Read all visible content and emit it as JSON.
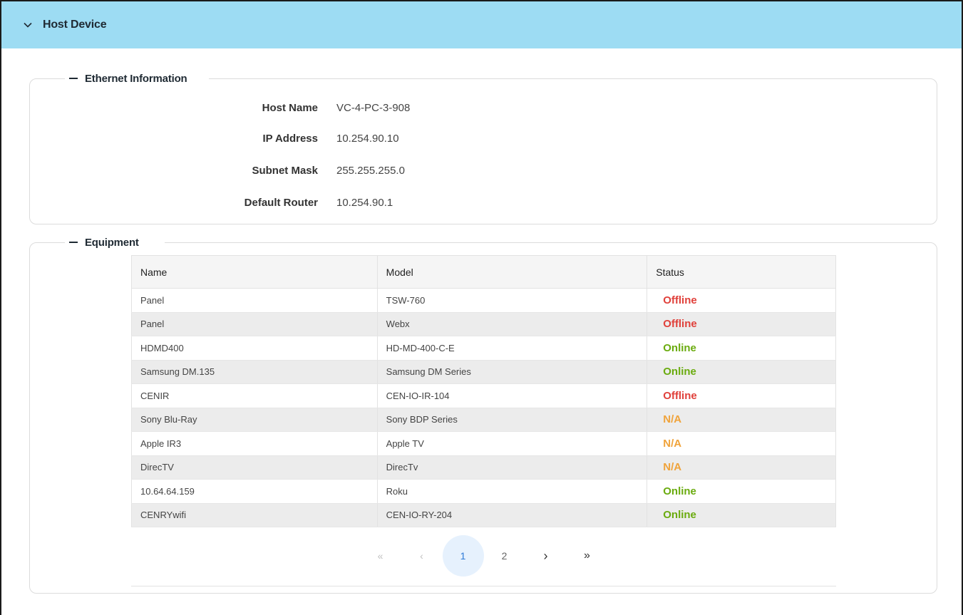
{
  "header": {
    "title": "Host Device",
    "icon": "chevron-down-icon"
  },
  "ethernet": {
    "legend": "Ethernet Information",
    "rows": [
      {
        "label": "Host Name",
        "value": "VC-4-PC-3-908"
      },
      {
        "label": "IP Address",
        "value": "10.254.90.10"
      },
      {
        "label": "Subnet Mask",
        "value": "255.255.255.0"
      },
      {
        "label": "Default Router",
        "value": "10.254.90.1"
      }
    ]
  },
  "equipment": {
    "legend": "Equipment",
    "columns": [
      "Name",
      "Model",
      "Status"
    ],
    "rows": [
      {
        "name": "Panel",
        "model": "TSW-760",
        "status": "Offline"
      },
      {
        "name": "Panel",
        "model": "Webx",
        "status": "Offline"
      },
      {
        "name": "HDMD400",
        "model": "HD-MD-400-C-E",
        "status": "Online"
      },
      {
        "name": "Samsung DM.135",
        "model": "Samsung DM Series",
        "status": "Online"
      },
      {
        "name": "CENIR",
        "model": "CEN-IO-IR-104",
        "status": "Offline"
      },
      {
        "name": "Sony Blu-Ray",
        "model": "Sony BDP Series",
        "status": "N/A"
      },
      {
        "name": "Apple IR3",
        "model": "Apple TV",
        "status": "N/A"
      },
      {
        "name": "DirecTV",
        "model": "DirecTv",
        "status": "N/A"
      },
      {
        "name": "10.64.64.159",
        "model": "Roku",
        "status": "Online"
      },
      {
        "name": "CENRYwifi",
        "model": "CEN-IO-RY-204",
        "status": "Online"
      }
    ],
    "status_colors": {
      "Offline": "#e0403a",
      "Online": "#6aab0e",
      "N/A": "#f0a33a"
    }
  },
  "pagination": {
    "first": "«",
    "prev": "‹",
    "pages": [
      "1",
      "2"
    ],
    "current": "1",
    "next": "›",
    "last": "»"
  },
  "colors": {
    "header_bg": "#9ddcf3",
    "accent": "#2f7bd6"
  }
}
